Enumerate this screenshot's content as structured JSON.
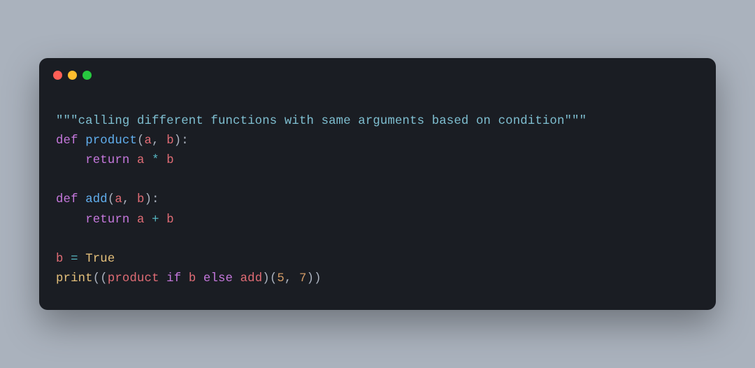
{
  "traffic_lights": {
    "r": "#ff5f56",
    "y": "#ffbd2e",
    "g": "#27c93f"
  },
  "code": {
    "l1": {
      "q1": "\"\"\"",
      "body": "calling different functions with same arguments based on condition",
      "q2": "\"\"\""
    },
    "l2": {
      "def": "def",
      "sp": " ",
      "name": "product",
      "lp": "(",
      "a": "a",
      "c1": ", ",
      "b": "b",
      "rp": ")",
      "colon": ":"
    },
    "l3": {
      "indent": "    ",
      "ret": "return",
      "sp1": " ",
      "a": "a",
      "sp2": " ",
      "op": "*",
      "sp3": " ",
      "b": "b"
    },
    "l4": {
      "blank": ""
    },
    "l5": {
      "def": "def",
      "sp": " ",
      "name": "add",
      "lp": "(",
      "a": "a",
      "c1": ", ",
      "b": "b",
      "rp": ")",
      "colon": ":"
    },
    "l6": {
      "indent": "    ",
      "ret": "return",
      "sp1": " ",
      "a": "a",
      "sp2": " ",
      "op": "+",
      "sp3": " ",
      "b": "b"
    },
    "l7": {
      "blank": ""
    },
    "l8": {
      "b": "b",
      "sp1": " ",
      "eq": "=",
      "sp2": " ",
      "val": "True"
    },
    "l9": {
      "print": "print",
      "lp1": "(",
      "lp2": "(",
      "product": "product",
      "sp1": " ",
      "if": "if",
      "sp2": " ",
      "b": "b",
      "sp3": " ",
      "else": "else",
      "sp4": " ",
      "add": "add",
      "rp2": ")",
      "lp3": "(",
      "five": "5",
      "comma": ", ",
      "seven": "7",
      "rp3": ")",
      "rp1": ")"
    }
  }
}
